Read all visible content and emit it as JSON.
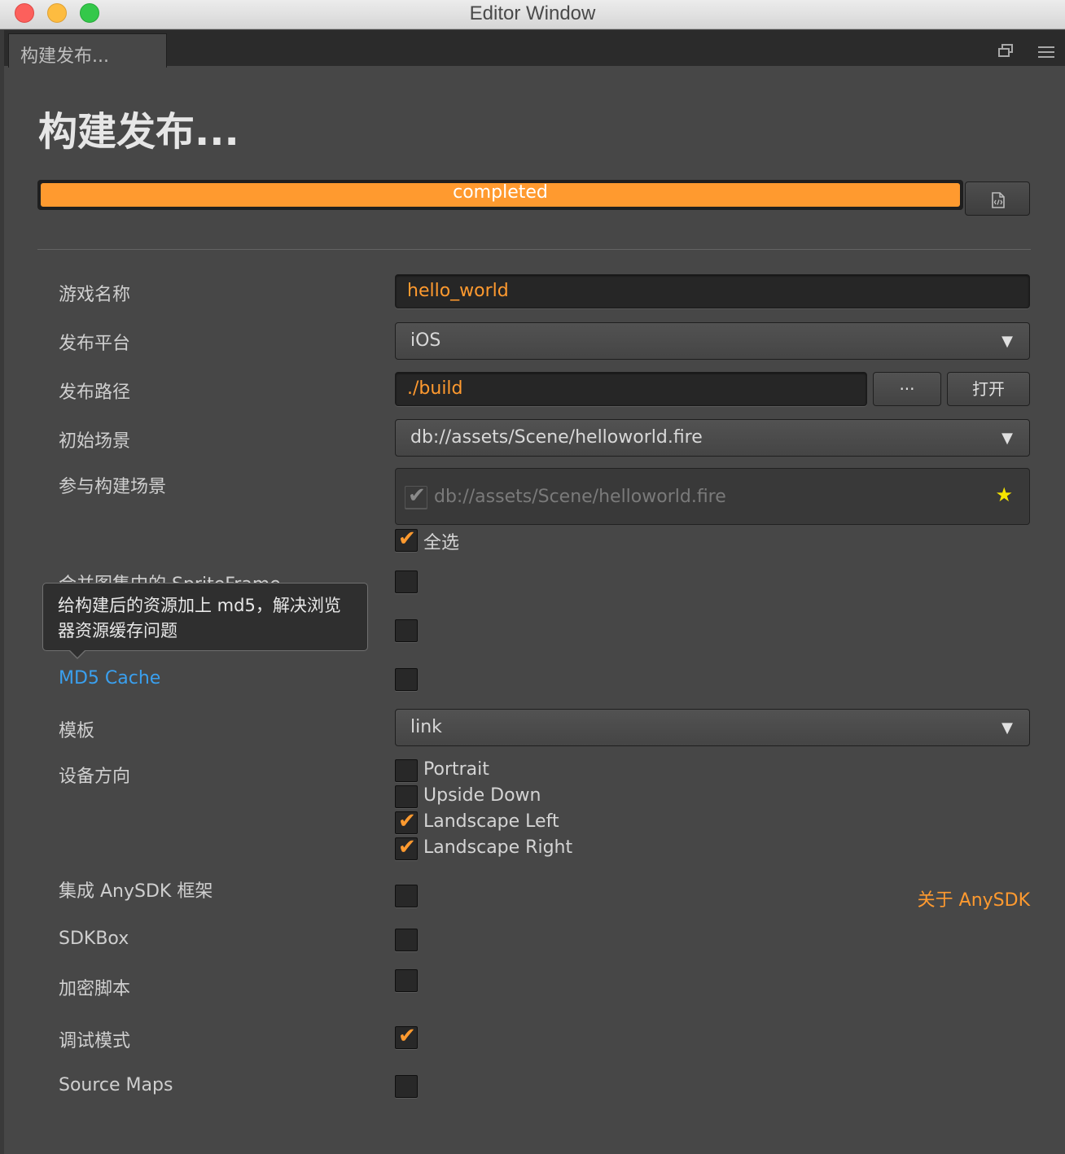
{
  "window": {
    "title": "Editor Window"
  },
  "tab": {
    "label": "构建发布..."
  },
  "page": {
    "title": "构建发布..."
  },
  "progress": {
    "text": "completed",
    "value": 1.0
  },
  "fields": {
    "game_name": {
      "label": "游戏名称",
      "value": "hello_world"
    },
    "platform": {
      "label": "发布平台",
      "value": "iOS"
    },
    "build_path": {
      "label": "发布路径",
      "value": "./build",
      "browse_label": "···",
      "open_label": "打开"
    },
    "start_scene": {
      "label": "初始场景",
      "value": "db://assets/Scene/helloworld.fire"
    },
    "included_scenes": {
      "label": "参与构建场景",
      "scenes": [
        "db://assets/Scene/helloworld.fire"
      ],
      "select_all_label": "全选",
      "select_all_checked": true
    },
    "merge_sprite": {
      "label": "合并图集中的 SpriteFrame",
      "checked": false
    },
    "second_option": {
      "checked": false
    },
    "md5_cache": {
      "label": "MD5 Cache",
      "checked": false,
      "tooltip": "给构建后的资源加上 md5，解决浏览器资源缓存问题"
    },
    "template": {
      "label": "模板",
      "value": "link"
    },
    "orientation": {
      "label": "设备方向",
      "options": [
        {
          "label": "Portrait",
          "checked": false
        },
        {
          "label": "Upside Down",
          "checked": false
        },
        {
          "label": "Landscape Left",
          "checked": true
        },
        {
          "label": "Landscape Right",
          "checked": true
        }
      ]
    },
    "anysdk": {
      "label": "集成 AnySDK 框架",
      "checked": false,
      "link": "关于 AnySDK"
    },
    "sdkbox": {
      "label": "SDKBox",
      "checked": false
    },
    "encrypt": {
      "label": "加密脚本",
      "checked": false
    },
    "debug": {
      "label": "调试模式",
      "checked": true
    },
    "source_maps": {
      "label": "Source Maps",
      "checked": false
    }
  },
  "colors": {
    "accent": "#ff9a2f",
    "link_blue": "#3aa0ef",
    "star": "#f7e600"
  },
  "icons": [
    "popout-icon",
    "menu-icon",
    "log-file-icon",
    "star-icon",
    "chevron-down-icon",
    "checkmark-icon"
  ]
}
